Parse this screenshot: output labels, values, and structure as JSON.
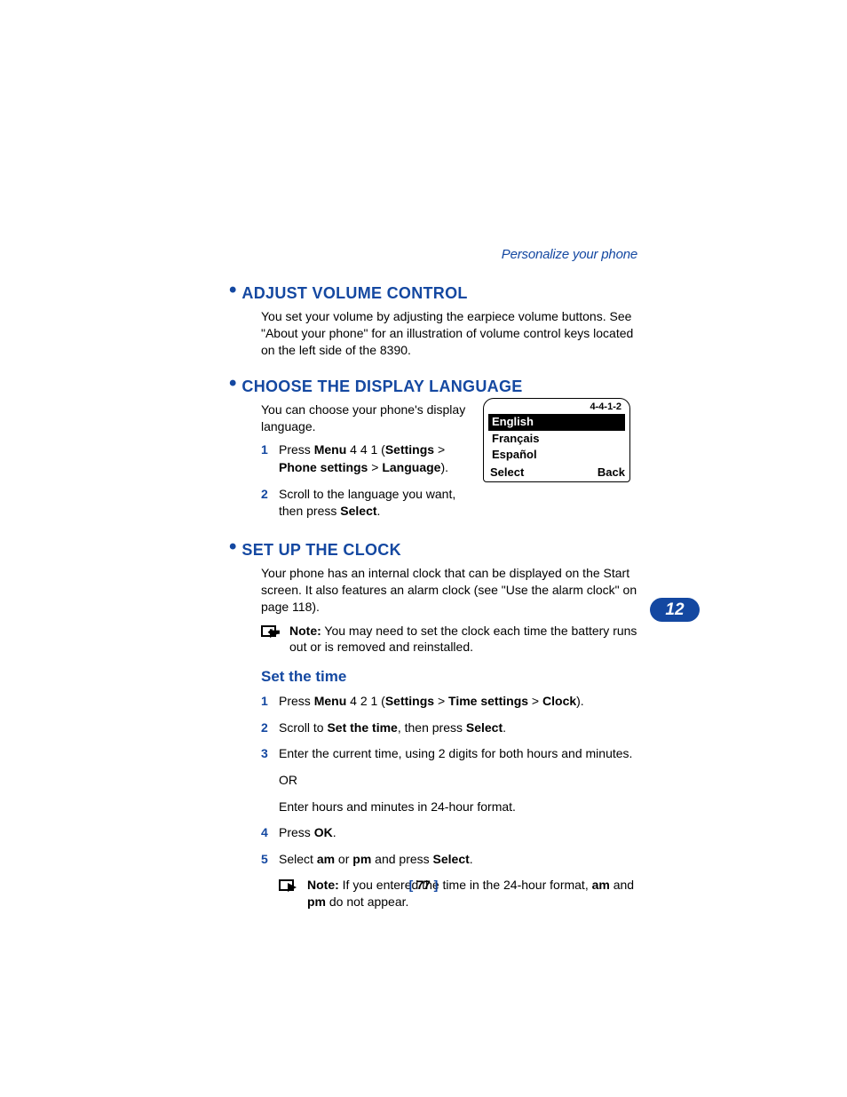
{
  "header": {
    "section_name": "Personalize your phone"
  },
  "sections": {
    "volume": {
      "title": "ADJUST VOLUME CONTROL",
      "body": "You set your volume by adjusting the earpiece volume buttons. See \"About your phone\" for an illustration of volume control keys located on the left side of the 8390."
    },
    "language": {
      "title": "CHOOSE THE DISPLAY LANGUAGE",
      "intro": "You can choose your phone's display language.",
      "step1_a": "Press ",
      "step1_b": " 4 4 1 (",
      "step1_c": " > ",
      "step1_d": " > ",
      "step1_e": ").",
      "step1_menu": "Menu",
      "step1_settings": "Settings",
      "step1_phone_settings": "Phone settings",
      "step1_language": "Language",
      "step2_a": "Scroll to the language you want, then press ",
      "step2_b": ".",
      "step2_select": "Select",
      "fig": {
        "menu_path": "4-4-1-2",
        "lang1": "English",
        "lang2": "Français",
        "lang3": "Español",
        "left_soft": "Select",
        "right_soft": "Back"
      }
    },
    "clock": {
      "title": "SET UP THE CLOCK",
      "intro": "Your phone has an internal clock that can be displayed on the Start screen. It also features an alarm clock (see \"Use the alarm clock\" on page 118).",
      "note1_label": "Note:",
      "note1_text": " You may need to set the clock each time the battery runs out or is removed and reinstalled.",
      "sub_title": "Set the time",
      "step1_a": "Press ",
      "step1_b": " 4 2 1 (",
      "step1_c": " > ",
      "step1_d": " > ",
      "step1_e": ").",
      "step1_menu": "Menu",
      "step1_settings": "Settings",
      "step1_time_settings": "Time settings",
      "step1_clock": "Clock",
      "step2_a": "Scroll to ",
      "step2_b": ", then press ",
      "step2_c": ".",
      "step2_set_time": "Set the time",
      "step2_select": "Select",
      "step3_line1": "Enter the current time, using 2 digits for both hours and minutes.",
      "step3_or": "OR",
      "step3_line2": "Enter hours and minutes in 24-hour format.",
      "step4_a": "Press ",
      "step4_b": ".",
      "step4_ok": "OK",
      "step5_a": "Select ",
      "step5_b": " or ",
      "step5_c": " and press ",
      "step5_d": ".",
      "step5_am": "am",
      "step5_pm": "pm",
      "step5_select": "Select",
      "note2_label": "Note:",
      "note2_a": " If you entered the time in the 24-hour format, ",
      "note2_b": " and ",
      "note2_c": " do not appear.",
      "note2_am": "am",
      "note2_pm": "pm"
    }
  },
  "chapter_num": "12",
  "page_number": "77"
}
